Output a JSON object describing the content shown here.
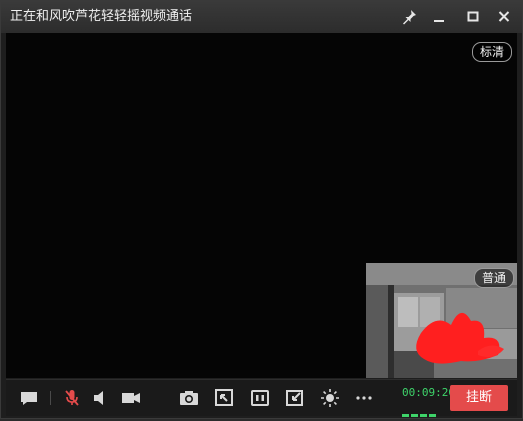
{
  "window": {
    "title": "正在和风吹芦花轻轻摇视频通话",
    "controls": [
      "pin-icon",
      "minimize-icon",
      "maximize-icon",
      "close-icon"
    ]
  },
  "main_video": {
    "quality_label": "标清"
  },
  "pip_video": {
    "quality_label": "普通"
  },
  "toolbar": {
    "tools": [
      {
        "name": "message-icon"
      },
      {
        "name": "microphone-muted-icon"
      },
      {
        "name": "speaker-icon"
      },
      {
        "name": "camera-icon"
      },
      {
        "name": "screenshot-icon"
      },
      {
        "name": "screen-share-icon"
      },
      {
        "name": "split-view-icon"
      },
      {
        "name": "pip-switch-icon"
      },
      {
        "name": "brightness-icon"
      },
      {
        "name": "more-icon"
      }
    ],
    "call_timer": "00:09:20",
    "hangup_label": "挂断"
  },
  "colors": {
    "timer": "#3ed46a",
    "hangup": "#e44b4b",
    "muted_mic": "#e44b4b",
    "redaction": "#ff1f1f"
  }
}
